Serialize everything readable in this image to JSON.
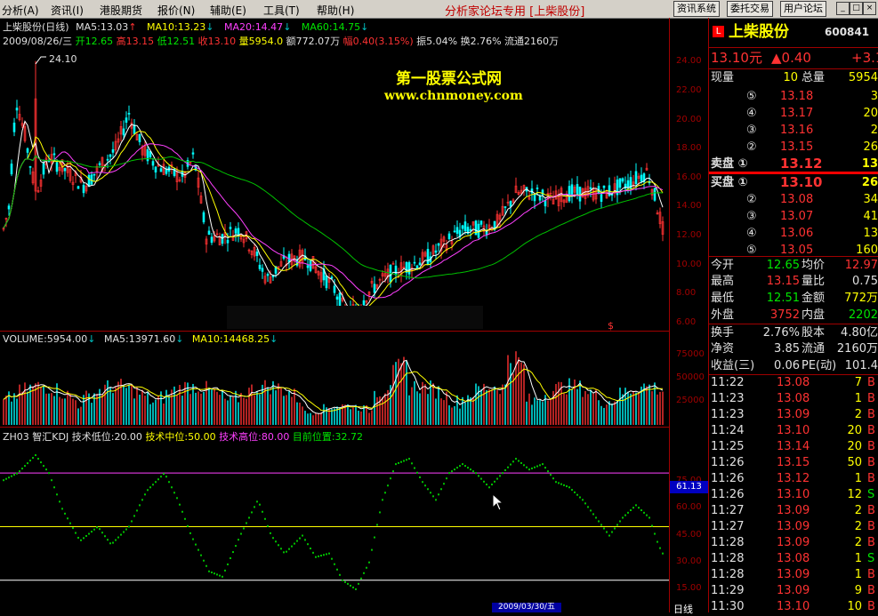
{
  "menu": {
    "items": [
      "分析(A)",
      "资讯(I)",
      "港股期货",
      "报价(N)",
      "辅助(E)",
      "工具(T)",
      "帮助(H)"
    ],
    "title": "分析家论坛专用 [上柴股份]",
    "buttons": [
      "资讯系统",
      "委托交易",
      "用户论坛"
    ],
    "sys": [
      "_",
      "□",
      "×"
    ]
  },
  "main_chart": {
    "line1": {
      "name": "上柴股份(日线)",
      "ma5": "MA5:13.03",
      "ma10": "MA10:13.23",
      "ma20": "MA20:14.47",
      "ma60": "MA60:14.75"
    },
    "line2": {
      "date": "2009/08/26/三",
      "open": "开12.65",
      "high": "高13.15",
      "low": "低12.51",
      "close": "收13.10",
      "vol": "量5954.0",
      "amt": "额772.07万",
      "chg": "幅0.40(3.15%)",
      "amp": "振5.04%",
      "turn": "换2.76%",
      "float": "流通2160万"
    },
    "peak_label": "24.10",
    "watermark1": "第一股票公式网",
    "watermark2": "www.chnmoney.com",
    "y_ticks": [
      "24.00",
      "22.00",
      "20.00",
      "18.00",
      "16.00",
      "14.00",
      "12.00",
      "10.00",
      "8.00",
      "6.00"
    ]
  },
  "volume_panel": {
    "label": "VOLUME:5954.00",
    "ma5": "MA5:13971.60",
    "ma10": "MA10:14468.25",
    "y_ticks": [
      "75000",
      "50000",
      "25000"
    ]
  },
  "kdj_panel": {
    "label": "ZH03 智汇KDJ",
    "low": "技术低位:20.00",
    "mid": "技术中位:50.00",
    "high": "技术高位:80.00",
    "cur": "目前位置:32.72",
    "y_ticks": [
      "75.00",
      "60.00",
      "45.00",
      "30.00",
      "15.00"
    ],
    "cursor_value": "61.13",
    "date_label": "2009/03/30/五",
    "period_label": "日线"
  },
  "quote": {
    "logo": "L",
    "name": "上柴股份",
    "code": "600841",
    "price": "13.10元",
    "change": "▲0.40",
    "pct": "+3.15",
    "now_vol_label": "现量",
    "now_vol": "10",
    "total_vol_label": "总量",
    "total_vol": "5954",
    "asks": [
      {
        "lvl": "⑤",
        "price": "13.18",
        "vol": "3"
      },
      {
        "lvl": "④",
        "price": "13.17",
        "vol": "20"
      },
      {
        "lvl": "③",
        "price": "13.16",
        "vol": "2"
      },
      {
        "lvl": "②",
        "price": "13.15",
        "vol": "26"
      },
      {
        "lvl": "卖盘 ①",
        "price": "13.12",
        "vol": "13"
      }
    ],
    "bids": [
      {
        "lvl": "买盘 ①",
        "price": "13.10",
        "vol": "26"
      },
      {
        "lvl": "②",
        "price": "13.08",
        "vol": "34"
      },
      {
        "lvl": "③",
        "price": "13.07",
        "vol": "41"
      },
      {
        "lvl": "④",
        "price": "13.06",
        "vol": "13"
      },
      {
        "lvl": "⑤",
        "price": "13.05",
        "vol": "160"
      }
    ],
    "stats": [
      {
        "l1": "今开",
        "v1": "12.65",
        "l2": "均价",
        "v2": "12.97"
      },
      {
        "l1": "最高",
        "v1": "13.15",
        "l2": "量比",
        "v2": "0.75"
      },
      {
        "l1": "最低",
        "v1": "12.51",
        "l2": "金额",
        "v2": "772万"
      },
      {
        "l1": "外盘",
        "v1": "3752",
        "l2": "内盘",
        "v2": "2202"
      }
    ],
    "stats2": [
      {
        "l1": "换手",
        "v1": "2.76%",
        "l2": "股本",
        "v2": "4.80亿"
      },
      {
        "l1": "净资",
        "v1": "3.85",
        "l2": "流通",
        "v2": "2160万"
      },
      {
        "l1": "收益(三)",
        "v1": "0.06",
        "l2": "PE(动)",
        "v2": "101.4"
      }
    ],
    "ticks": [
      {
        "t": "11:22",
        "p": "13.08",
        "v": "7",
        "d": "B"
      },
      {
        "t": "11:23",
        "p": "13.08",
        "v": "1",
        "d": "B"
      },
      {
        "t": "11:23",
        "p": "13.09",
        "v": "2",
        "d": "B"
      },
      {
        "t": "11:24",
        "p": "13.10",
        "v": "20",
        "d": "B"
      },
      {
        "t": "11:25",
        "p": "13.14",
        "v": "20",
        "d": "B"
      },
      {
        "t": "11:26",
        "p": "13.15",
        "v": "50",
        "d": "B"
      },
      {
        "t": "11:26",
        "p": "13.12",
        "v": "1",
        "d": "B"
      },
      {
        "t": "11:26",
        "p": "13.10",
        "v": "12",
        "d": "S"
      },
      {
        "t": "11:27",
        "p": "13.09",
        "v": "2",
        "d": "B"
      },
      {
        "t": "11:27",
        "p": "13.09",
        "v": "2",
        "d": "B"
      },
      {
        "t": "11:28",
        "p": "13.09",
        "v": "2",
        "d": "B"
      },
      {
        "t": "11:28",
        "p": "13.08",
        "v": "1",
        "d": "S"
      },
      {
        "t": "11:28",
        "p": "13.09",
        "v": "1",
        "d": "B"
      },
      {
        "t": "11:29",
        "p": "13.09",
        "v": "9",
        "d": "B"
      },
      {
        "t": "11:30",
        "p": "13.10",
        "v": "10",
        "d": "B"
      }
    ]
  },
  "colors": {
    "up": "#ff3232",
    "down": "#00e600",
    "bg": "#000000",
    "grid": "#a00000",
    "ma5": "#ffffff",
    "ma10": "#ffff00",
    "ma20": "#ff40ff",
    "ma60": "#00c000",
    "kdj": "#00c000"
  }
}
